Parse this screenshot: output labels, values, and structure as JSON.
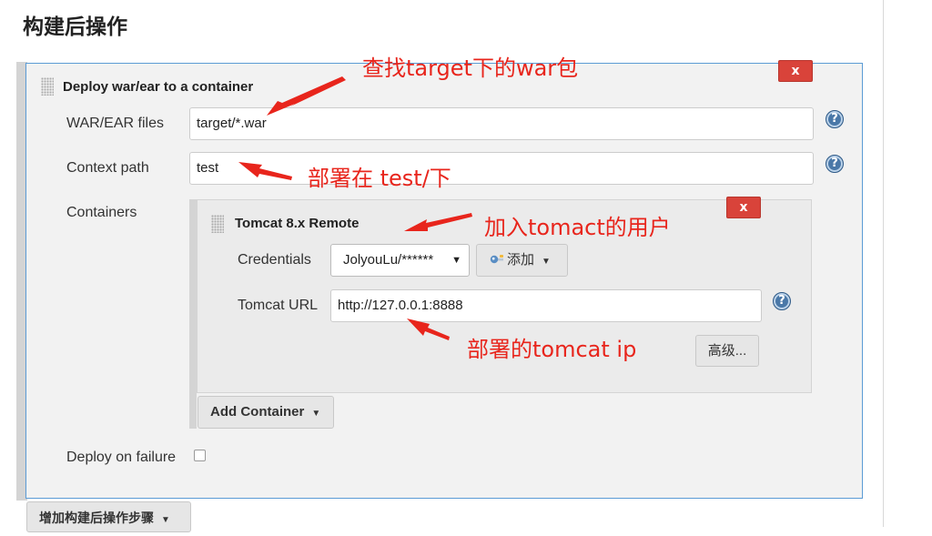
{
  "section": {
    "title": "构建后操作"
  },
  "deploy_panel": {
    "title": "Deploy war/ear to a container",
    "delete_label": "x",
    "war_files": {
      "label": "WAR/EAR files",
      "value": "target/*.war"
    },
    "context_path": {
      "label": "Context path",
      "value": "test"
    },
    "containers_label": "Containers",
    "help_label": "?",
    "deploy_on_failure": {
      "label": "Deploy on failure",
      "checked": false
    },
    "add_container_label": "Add Container"
  },
  "tomcat_panel": {
    "title": "Tomcat 8.x Remote",
    "delete_label": "x",
    "credentials": {
      "label": "Credentials",
      "selected": "JolyouLu/******",
      "add_label": "添加",
      "add_icon": "key-icon"
    },
    "tomcat_url": {
      "label": "Tomcat URL",
      "value": "http://127.0.0.1:8888"
    },
    "advanced_label": "高级..."
  },
  "footer": {
    "add_step_label": "增加构建后操作步骤"
  },
  "annotations": {
    "find_war": "查找target下的war包",
    "deploy_path": "部署在 test/下",
    "add_user": "加入tomact的用户",
    "deploy_ip": "部署的tomcat ip",
    "color": "#e8251c"
  },
  "colors": {
    "delete": "#d9433a",
    "panel_border": "#5b9bd5",
    "help": "#4a78a8"
  }
}
